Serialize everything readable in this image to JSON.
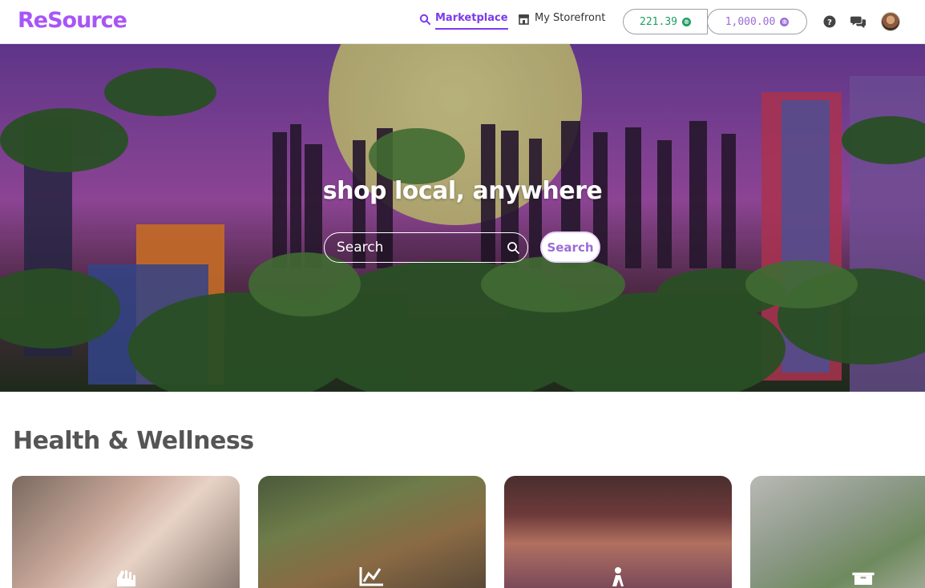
{
  "header": {
    "logo": "ReSource",
    "nav": [
      {
        "label": "Marketplace",
        "icon": "search-icon",
        "active": true
      },
      {
        "label": "My Storefront",
        "icon": "storefront-icon",
        "active": false
      }
    ],
    "balances": {
      "available": "221.39",
      "credit_limit": "1,000.00",
      "available_color": "#1f9d63",
      "credit_color": "#9b6dd6"
    },
    "icons": [
      "help-icon",
      "chat-icon",
      "avatar"
    ]
  },
  "hero": {
    "title": "shop local, anywhere",
    "search_placeholder": "Search",
    "search_button": "Search"
  },
  "section": {
    "title": "Health & Wellness",
    "cards": [
      {
        "icon": "hand-icon"
      },
      {
        "icon": "chart-icon"
      },
      {
        "icon": "person-icon"
      },
      {
        "icon": "box-icon"
      }
    ]
  },
  "colors": {
    "brand": "#a855f7",
    "accent": "#7c3aed"
  }
}
